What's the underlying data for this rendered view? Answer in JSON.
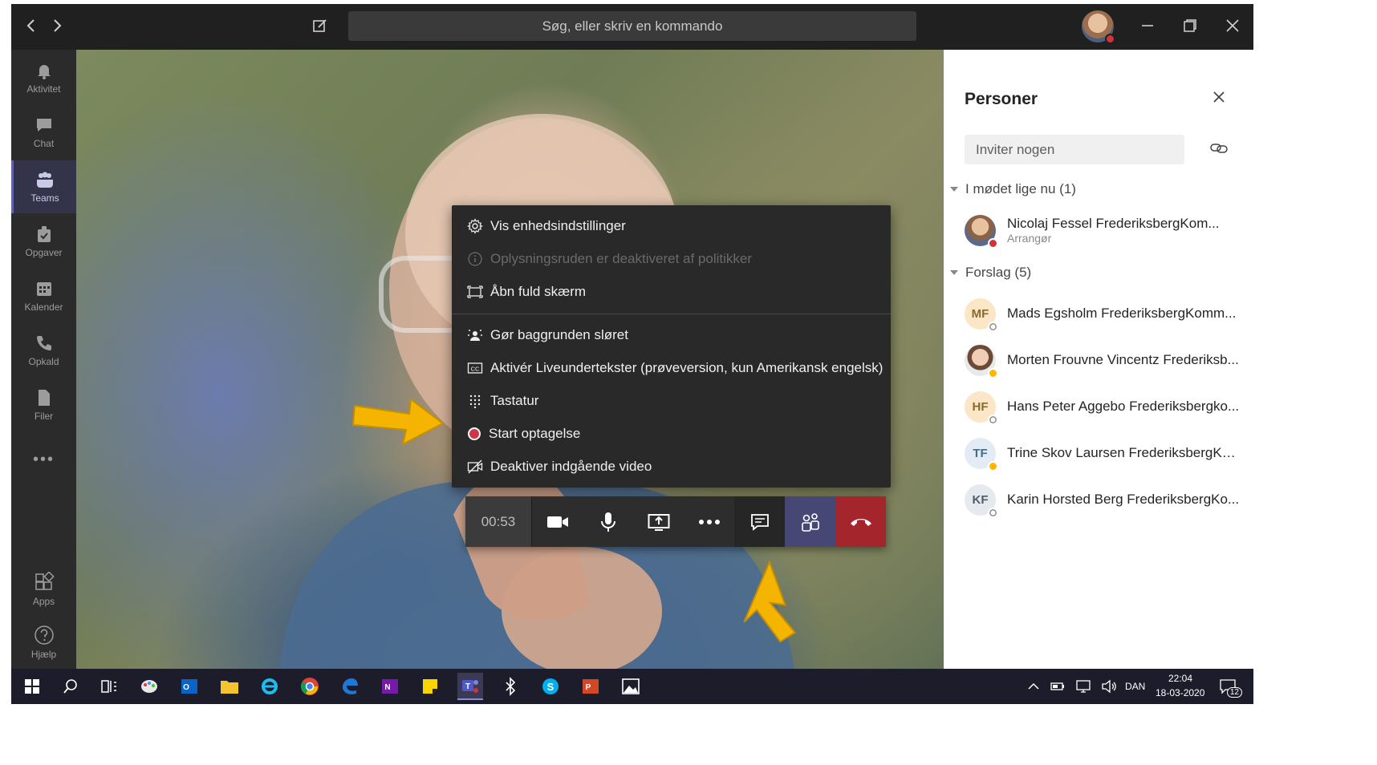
{
  "titlebar": {
    "search_placeholder": "Søg, eller skriv en kommando"
  },
  "rail": {
    "items": [
      {
        "label": "Aktivitet",
        "icon": "bell-icon"
      },
      {
        "label": "Chat",
        "icon": "chat-icon"
      },
      {
        "label": "Teams",
        "icon": "teams-icon"
      },
      {
        "label": "Opgaver",
        "icon": "tasks-icon"
      },
      {
        "label": "Kalender",
        "icon": "calendar-icon"
      },
      {
        "label": "Opkald",
        "icon": "phone-icon"
      },
      {
        "label": "Filer",
        "icon": "file-icon"
      }
    ],
    "more": "•••",
    "apps": "Apps",
    "help": "Hjælp",
    "active": "Teams"
  },
  "menu": {
    "items": [
      {
        "label": "Vis enhedsindstillinger",
        "icon": "gear-icon"
      },
      {
        "label": "Oplysningsruden er deaktiveret af politikker",
        "icon": "info-icon",
        "disabled": true
      },
      {
        "label": "Åbn fuld skærm",
        "icon": "fullscreen-icon"
      },
      {
        "label": "Gør baggrunden sløret",
        "icon": "blur-icon"
      },
      {
        "label": "Aktivér Liveundertekster (prøveversion, kun Amerikansk engelsk)",
        "icon": "captions-icon"
      },
      {
        "label": "Tastatur",
        "icon": "keypad-icon"
      },
      {
        "label": "Start optagelse",
        "icon": "record-icon"
      },
      {
        "label": "Deaktiver indgående video",
        "icon": "video-off-icon"
      }
    ]
  },
  "callbar": {
    "timer": "00:53"
  },
  "panel": {
    "title": "Personer",
    "invite_placeholder": "Inviter nogen",
    "in_meeting_header": "I mødet lige nu (1)",
    "in_meeting": [
      {
        "name": "Nicolaj Fessel FrederiksbergKom...",
        "role": "Arrangør"
      }
    ],
    "suggestions_header": "Forslag (5)",
    "suggestions": [
      {
        "initials": "MF",
        "name": "Mads Egsholm FrederiksbergKomm...",
        "status": "offline"
      },
      {
        "initials": "",
        "name": "Morten Frouvne Vincentz Frederiksb...",
        "status": "away"
      },
      {
        "initials": "HF",
        "name": "Hans Peter Aggebo Frederiksbergko...",
        "status": "offline"
      },
      {
        "initials": "TF",
        "name": "Trine Skov Laursen FrederiksbergKo...",
        "status": "away"
      },
      {
        "initials": "KF",
        "name": "Karin Horsted Berg FrederiksbergKo...",
        "status": "offline"
      }
    ]
  },
  "taskbar": {
    "language": "DAN",
    "time": "22:04",
    "date": "18-03-2020",
    "notifications": "12"
  },
  "colors": {
    "accent": "#6264a7",
    "hangup": "#a4262c",
    "arrow": "#f5b400",
    "record": "#d13448"
  }
}
